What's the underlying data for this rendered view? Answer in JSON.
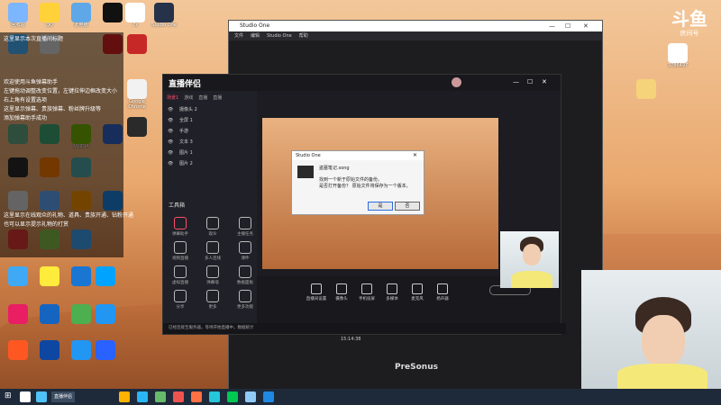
{
  "desktop": {
    "overlay_lines": [
      "这里显示本次直播间标题",
      "欢迎使用斗鱼弹幕助手",
      "左键拖动调整改变位置，左键拉伸边框改变大小",
      "右上角有设置选项",
      "这里显示弹幕、贵族弹幕、粉丝牌升级等",
      "添加弹幕助手成功",
      "这里显示在线观众的礼物、道具、贵族开通、钻粉开通",
      "也可以显示提示礼物的打赏"
    ],
    "icons": [
      {
        "label": "回收站",
        "color": "#7bb6ff"
      },
      {
        "label": "QQ",
        "color": "#ffd23a"
      },
      {
        "label": "此电脑",
        "color": "#5fa8e8"
      },
      {
        "label": "",
        "color": "#111111"
      },
      {
        "label": "7z",
        "color": "#ffffff"
      },
      {
        "label": "Studio One",
        "color": "#26324a"
      },
      {
        "label": "",
        "color": "#4bb4ff"
      },
      {
        "label": "",
        "color": "#e0e0e0"
      },
      {
        "label": "",
        "color": "#d22"
      },
      {
        "label": "",
        "color": "#c62828"
      },
      {
        "label": "Google Chrome",
        "color": "#f2f2f2"
      },
      {
        "label": "",
        "color": "#2a2a2a"
      },
      {
        "label": "",
        "color": "#6a8"
      },
      {
        "label": "",
        "color": "#4a7"
      },
      {
        "label": "NVIDIA",
        "color": "#76b900"
      },
      {
        "label": "",
        "color": "#3366cc"
      },
      {
        "label": "",
        "color": "#2c2c2c"
      },
      {
        "label": "",
        "color": "#ff7b00"
      },
      {
        "label": "",
        "color": "#5aa"
      },
      {
        "label": "",
        "color": "#ddd"
      },
      {
        "label": "",
        "color": "#66aaff"
      },
      {
        "label": "",
        "color": "#ff9800"
      },
      {
        "label": "",
        "color": "#1e88e5"
      },
      {
        "label": "",
        "color": "#e53935"
      },
      {
        "label": "",
        "color": "#8bc34a"
      },
      {
        "label": "",
        "color": "#42a5f5"
      },
      {
        "label": "",
        "color": "#3fa9f5"
      },
      {
        "label": "",
        "color": "#ffeb3b"
      },
      {
        "label": "",
        "color": "#1976d2"
      },
      {
        "label": "",
        "color": "#00a3ff"
      },
      {
        "label": "",
        "color": "#e91e63"
      },
      {
        "label": "",
        "color": "#1565c0"
      },
      {
        "label": "",
        "color": "#4caf50"
      },
      {
        "label": "",
        "color": "#2196f3"
      },
      {
        "label": "",
        "color": "#ff5722"
      },
      {
        "label": "",
        "color": "#0d47a1"
      },
      {
        "label": "",
        "color": "#2196f3"
      },
      {
        "label": "",
        "color": "#2962ff"
      }
    ],
    "right_icons": [
      {
        "label": "3786497",
        "color": "#ffffff"
      },
      {
        "label": "",
        "color": "#f5d37a"
      }
    ]
  },
  "douyu_badge": {
    "logo": "斗鱼",
    "sub": "房间号"
  },
  "studio_one": {
    "title": "Studio One",
    "menu": [
      "文件",
      "编辑",
      "Studio One",
      "帮助"
    ],
    "brand": "PreSonus"
  },
  "companion": {
    "brand": "直播伴侣",
    "source_tabs": [
      "场景1",
      "游戏",
      "直播",
      "直播"
    ],
    "sources": [
      "摄像头 2",
      "全屏 1",
      "手游",
      "文本 3",
      "图片 1",
      "图片 2"
    ],
    "tools_title": "工具箱",
    "tools": [
      "弹幕助手",
      "观众",
      "主播任务",
      "视频直播",
      "多人连线",
      "课件",
      "虚拟直播",
      "弹幕墙",
      "数据面板",
      "分享",
      "更多",
      "更多功能"
    ],
    "bottom_buttons": [
      "直播间设置",
      "摄像头",
      "手机投屏",
      "多媒体",
      "麦克风",
      "扬声器"
    ],
    "status_text": "已经连接至服务器，等待开始直播中，数据统计",
    "time": "15:14:38"
  },
  "dialog": {
    "title": "Studio One",
    "message_lines": [
      "盗墓笔记.song",
      "找到一个新于原始文件的备份。",
      "是否打开备份？ 原始文件将保存为一个版本。"
    ],
    "buttons": [
      "是",
      "否"
    ]
  },
  "taskbar": {
    "search_placeholder": "",
    "running_label": "直播伴侣",
    "task_colors": [
      "#ffffff",
      "#4fc3f7",
      "#ffb300",
      "#29b6f6",
      "#66bb6a",
      "#ef5350",
      "#ff7043",
      "#26c6da",
      "#00c853",
      "#90caf9",
      "#1e88e5"
    ]
  }
}
